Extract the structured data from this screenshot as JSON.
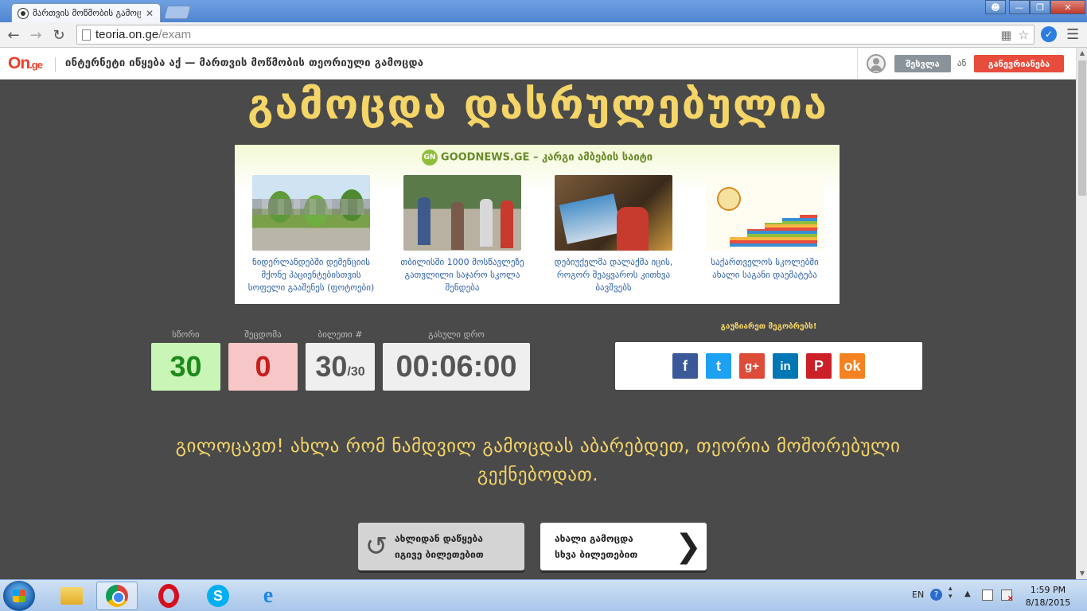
{
  "browser": {
    "tab_title": "მართვის მოწმობის გამოც",
    "tab_close": "✕",
    "url_host": "teoria.on.ge",
    "url_path": "/exam"
  },
  "header": {
    "logo_main": "On",
    "logo_suffix": ".ge",
    "title": "ინტერნეტი იწყება აქ — მართვის მოწმობის თეორიული გამოცდა",
    "login_label": "შესვლა",
    "or_label": "ან",
    "register_label": "განევრიანება"
  },
  "main": {
    "title": "გამოცდა დასრულებულია",
    "news": {
      "source": "GOODNEWS.GE",
      "tagline": "– კარგი ამბების საიტი",
      "badge": "GN",
      "items": [
        {
          "caption": "ნიდერლანდებში დემენციის მქონე პაციენტებისთვის სოფელი გააშენეს (ფოტოები)"
        },
        {
          "caption": "თბილისში 1000 მოსწავლეზე გათვლილი საჯარო სკოლა შენდება"
        },
        {
          "caption": "დებიუქელმა დალაქმა იცის, როგორ შეაყვაროს კითხვა ბავშვებს"
        },
        {
          "caption": "საქართველოს სკოლებში ახალი საგანი დაემატება"
        }
      ]
    },
    "stats": {
      "score_label": "სწორი",
      "score": "30",
      "errors_label": "შეცდომა",
      "errors": "0",
      "ticket_label": "ბილეთი #",
      "ticket": "30",
      "ticket_total": "/30",
      "time_label": "გასული დრო",
      "time": "00:06:00"
    },
    "share": {
      "label": "გაუზიარეთ მეგობრებს!",
      "networks": [
        {
          "name": "facebook",
          "glyph": "f"
        },
        {
          "name": "twitter",
          "glyph": "t"
        },
        {
          "name": "google-plus",
          "glyph": "g+"
        },
        {
          "name": "linkedin",
          "glyph": "in"
        },
        {
          "name": "pinterest",
          "glyph": "P"
        },
        {
          "name": "odnoklassniki",
          "glyph": "ok"
        }
      ]
    },
    "congrats": "გილოცავთ! ახლა რომ ნამდვილ გამოცდას აბარებდეთ, თეორია მოშორებული გექნებოდათ.",
    "restart": {
      "line1": "ახლიდან დაწყება",
      "line2": "იგივე ბილეთებით"
    },
    "new_exam": {
      "line1": "ახალი გამოცდა",
      "line2": "სხვა ბილეთებით"
    }
  },
  "taskbar": {
    "lang": "EN",
    "time": "1:59 PM",
    "date": "8/18/2015"
  }
}
